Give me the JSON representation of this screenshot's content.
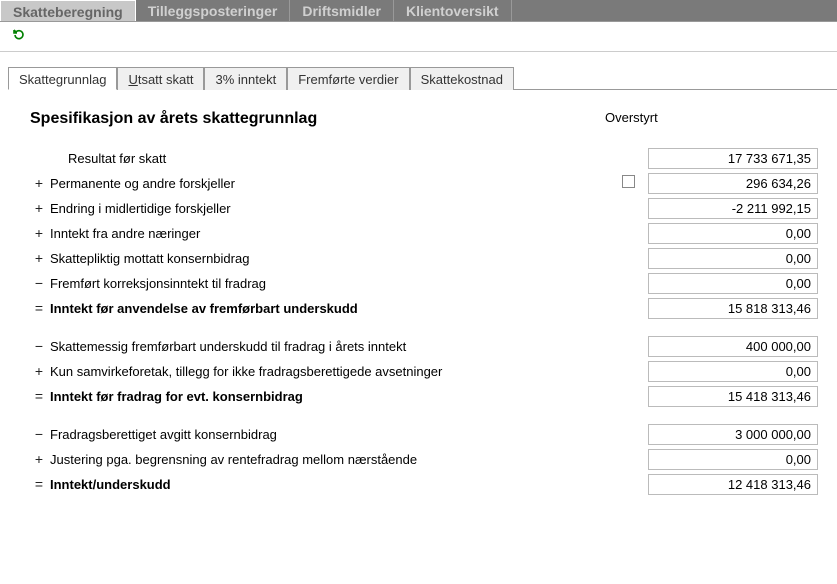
{
  "top_tabs": {
    "t0": "Skatteberegning",
    "t1": "Tilleggsposteringer",
    "t2": "Driftsmidler",
    "t3": "Klientoversikt"
  },
  "sub_tabs": {
    "s0": "Skattegrunnlag",
    "s1_pre": "U",
    "s1_rest": "tsatt skatt",
    "s2": "3% inntekt",
    "s3": "Fremførte verdier",
    "s4": "Skattekostnad"
  },
  "section_title": "Spesifikasjon av årets skattegrunnlag",
  "overstyrt_label": "Overstyrt",
  "lines": {
    "l0_label": "Resultat før skatt",
    "l0_val": "17 733 671,35",
    "l1_op": "+",
    "l1_label": "Permanente og andre forskjeller",
    "l1_val": "296 634,26",
    "l2_op": "+",
    "l2_label": "Endring i midlertidige forskjeller",
    "l2_val": "-2 211 992,15",
    "l3_op": "+",
    "l3_label": "Inntekt fra andre næringer",
    "l3_val": "0,00",
    "l4_op": "+",
    "l4_label": "Skattepliktig mottatt konsernbidrag",
    "l4_val": "0,00",
    "l5_op": "−",
    "l5_label": "Fremført korreksjonsinntekt til fradrag",
    "l5_val": "0,00",
    "l6_op": "=",
    "l6_label": "Inntekt før anvendelse av fremførbart underskudd",
    "l6_val": "15 818 313,46",
    "l7_op": "−",
    "l7_label": "Skattemessig fremførbart underskudd til fradrag i årets inntekt",
    "l7_val": "400 000,00",
    "l8_op": "+",
    "l8_label": "Kun samvirkeforetak, tillegg for ikke fradragsberettigede avsetninger",
    "l8_val": "0,00",
    "l9_op": "=",
    "l9_label": "Inntekt før fradrag for evt. konsernbidrag",
    "l9_val": "15 418 313,46",
    "l10_op": "−",
    "l10_label": "Fradragsberettiget avgitt konsernbidrag",
    "l10_val": "3 000 000,00",
    "l11_op": "+",
    "l11_label": "Justering pga. begrensning av rentefradrag mellom nærstående",
    "l11_val": "0,00",
    "l12_op": "=",
    "l12_label": "Inntekt/underskudd",
    "l12_val": "12 418 313,46"
  }
}
